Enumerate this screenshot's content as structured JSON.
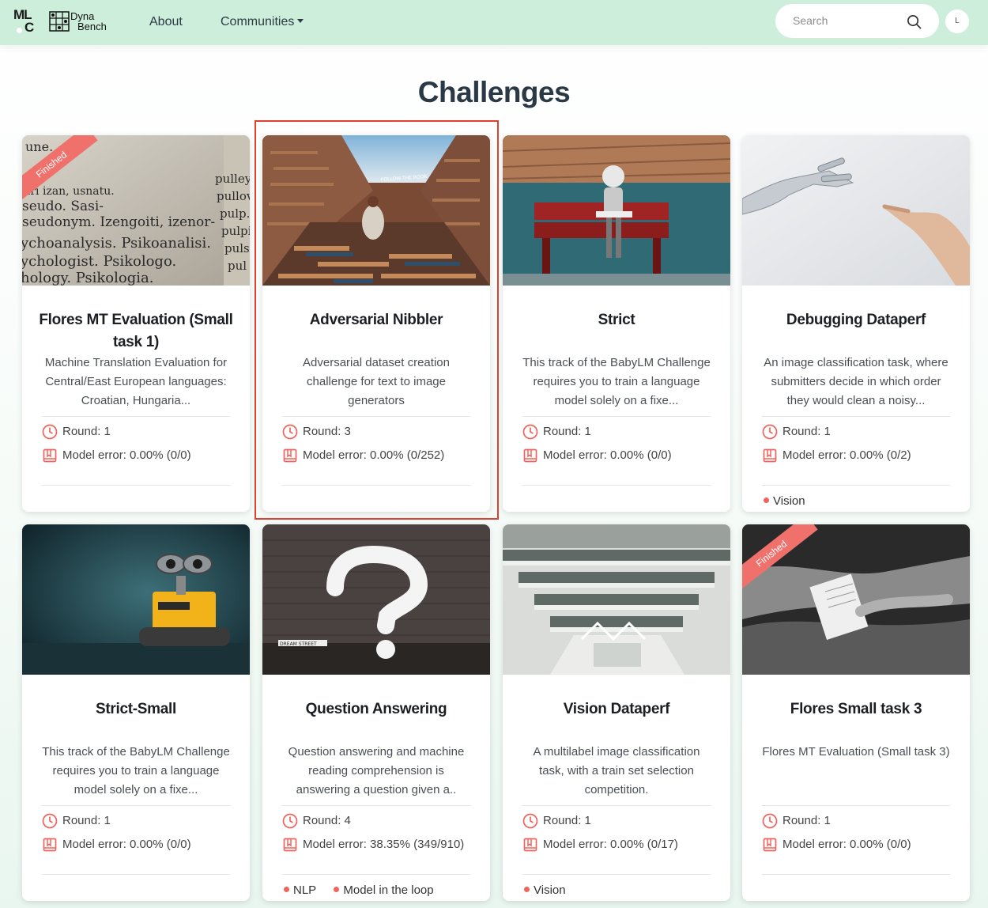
{
  "brand": {
    "mlc_top": "ML",
    "mlc_bottom": "C",
    "dyna_top": "Dyna",
    "dyna_bottom": "Bench"
  },
  "nav": {
    "about": "About",
    "communities": "Communities"
  },
  "search": {
    "placeholder": "Search"
  },
  "user": {
    "avatar_initial": "L"
  },
  "page": {
    "title": "Challenges"
  },
  "cards": [
    {
      "title": "Flores MT Evaluation (Small task 1)",
      "description": "Machine Translation Evaluation for Central/East European languages: Croatian, Hungaria...",
      "round": "Round: 1",
      "model_error": "Model error: 0.00% (0/0)",
      "ribbon": "Finished",
      "tags": []
    },
    {
      "title": "Adversarial Nibbler",
      "description": "Adversarial dataset creation challenge for text to image generators",
      "round": "Round: 3",
      "model_error": "Model error: 0.00% (0/252)",
      "ribbon": "",
      "tags": []
    },
    {
      "title": "Strict",
      "description": "This track of the BabyLM Challenge requires you to train a language model solely on a fixe...",
      "round": "Round: 1",
      "model_error": "Model error: 0.00% (0/0)",
      "ribbon": "",
      "tags": []
    },
    {
      "title": "Debugging Dataperf",
      "description": "An image classification task, where submitters decide in which order they would clean a noisy...",
      "round": "Round: 1",
      "model_error": "Model error: 0.00% (0/2)",
      "ribbon": "",
      "tags": [
        "Vision"
      ]
    },
    {
      "title": "Strict-Small",
      "description": "This track of the BabyLM Challenge requires you to train a language model solely on a fixe...",
      "round": "Round: 1",
      "model_error": "Model error: 0.00% (0/0)",
      "ribbon": "",
      "tags": []
    },
    {
      "title": "Question Answering",
      "description": "Question answering and machine reading comprehension is answering a question given a..",
      "round": "Round: 4",
      "model_error": "Model error: 38.35% (349/910)",
      "ribbon": "",
      "tags": [
        "NLP",
        "Model in the loop"
      ]
    },
    {
      "title": "Vision Dataperf",
      "description": "A multilabel image classification task, with a train set selection competition.",
      "round": "Round: 1",
      "model_error": "Model error: 0.00% (0/17)",
      "ribbon": "",
      "tags": [
        "Vision"
      ]
    },
    {
      "title": "Flores Small task 3",
      "description": "Flores MT Evaluation (Small task 3)",
      "round": "Round: 1",
      "model_error": "Model error: 0.00% (0/0)",
      "ribbon": "Finished",
      "tags": []
    }
  ],
  "image_text": {
    "book_words": [
      "une.",
      "ari izan, usnatu.",
      "seudo. Sasi-",
      "seudonym. Izengoiti, izenor-",
      "ychoanalysis. Psikoanalisi.",
      "ychologist. Psikologo.",
      "hology. Psikologia."
    ],
    "book_side": [
      "pulley",
      "pullov",
      "pulp.",
      "pulpi",
      "puls",
      "pul"
    ],
    "street_sign": "FOLLOW THE ROOK",
    "wall_sign": "DREAM STREET"
  },
  "colors": {
    "nav_bg": "#cdeedb",
    "accent": "#f0716c",
    "icon": "#f0645e",
    "highlight": "#e0402e"
  }
}
